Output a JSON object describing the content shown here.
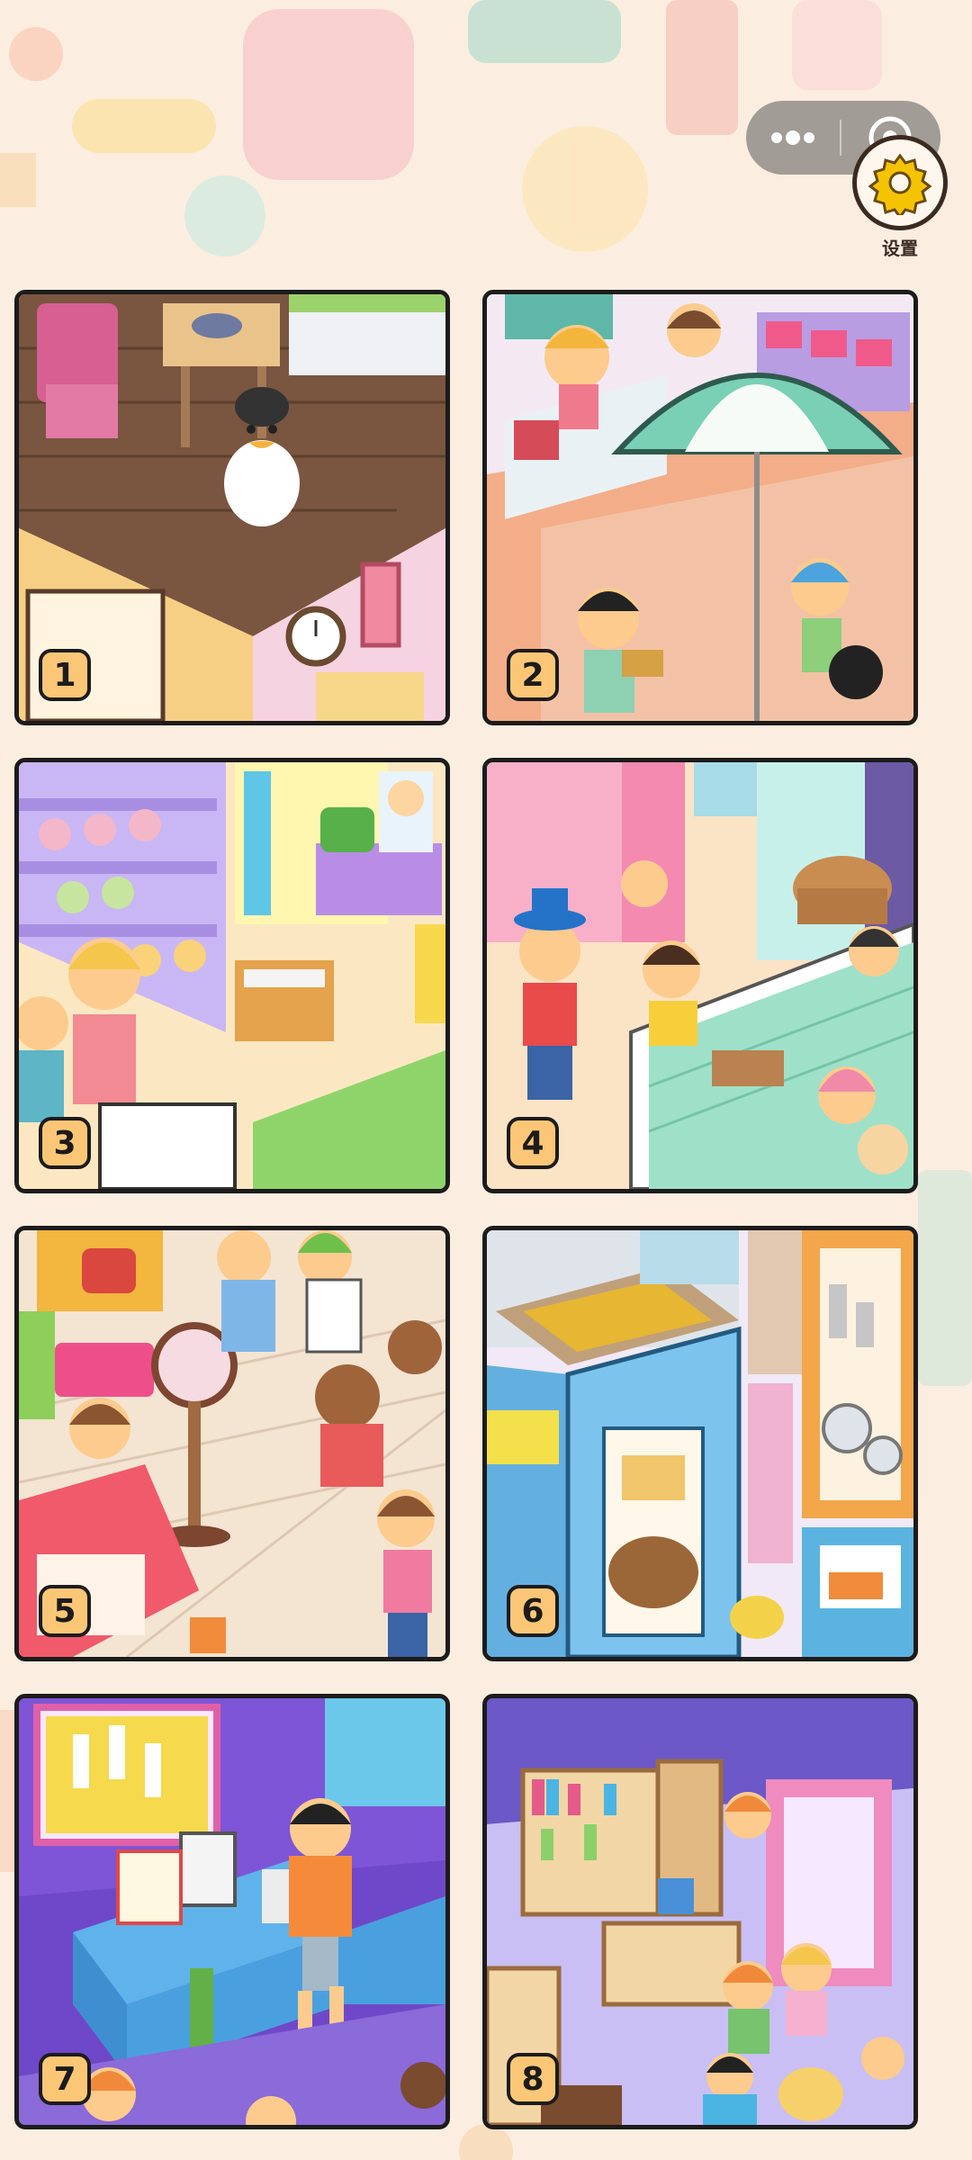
{
  "header": {
    "capsule": {
      "more_icon": "more-dots-icon",
      "close_icon": "target-circle-icon"
    },
    "settings": {
      "label": "设置",
      "icon": "gear-icon"
    }
  },
  "levels": [
    {
      "number": "1",
      "theme": "dining-room-penguin",
      "accent": "#f7c9d8"
    },
    {
      "number": "2",
      "theme": "market-umbrella",
      "accent": "#f3ad88"
    },
    {
      "number": "3",
      "theme": "dessert-shop",
      "accent": "#c9b6f4"
    },
    {
      "number": "4",
      "theme": "bakery-cafe",
      "accent": "#9fe0c9"
    },
    {
      "number": "5",
      "theme": "street-crossing",
      "accent": "#f4e4d2"
    },
    {
      "number": "6",
      "theme": "arcade-shop",
      "accent": "#6fbbe8"
    },
    {
      "number": "7",
      "theme": "reception-desk",
      "accent": "#8b6ad9"
    },
    {
      "number": "8",
      "theme": "bookstore",
      "accent": "#b3a6ef"
    }
  ],
  "colors": {
    "background": "#fbeee0",
    "badge": "#fbc777",
    "border": "#1d1b1b"
  }
}
